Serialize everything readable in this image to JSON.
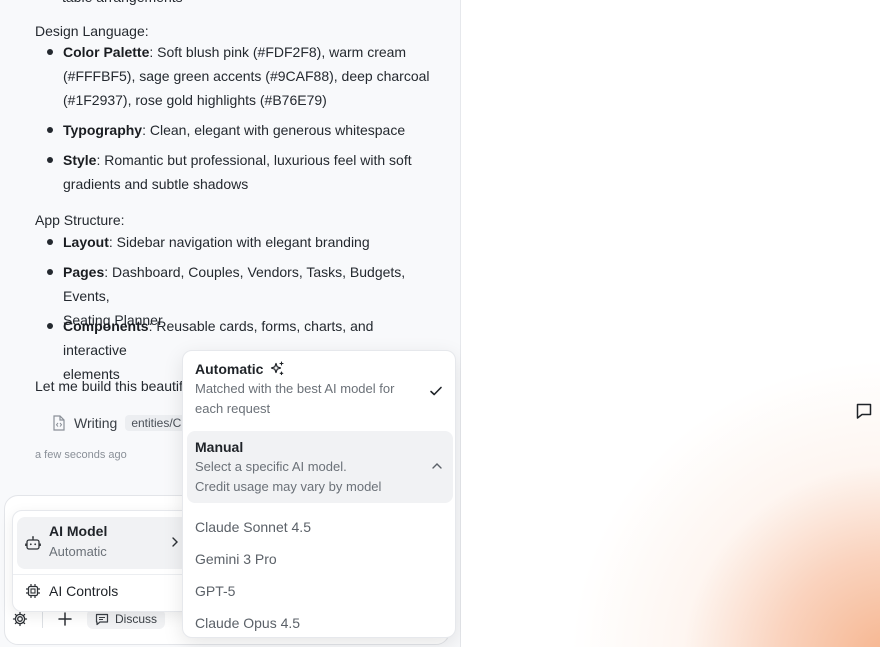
{
  "chat": {
    "cut_line": "table arrangements",
    "design_heading": "Design Language:",
    "design_items": [
      {
        "label": "Color Palette",
        "lines": [
          "Soft blush pink (#FDF2F8), warm cream",
          "(#FFFBF5), sage green accents (#9CAF88), deep charcoal",
          "(#1F2937), rose gold highlights (#B76E79)"
        ]
      },
      {
        "label": "Typography",
        "lines": [
          "Clean, elegant with generous whitespace"
        ]
      },
      {
        "label": "Style",
        "lines": [
          "Romantic but professional, luxurious feel with soft",
          "gradients and subtle shadows"
        ]
      }
    ],
    "structure_heading": "App Structure:",
    "structure_items": [
      {
        "label": "Layout",
        "lines": [
          "Sidebar navigation with elegant branding"
        ]
      },
      {
        "label": "Pages",
        "lines": [
          "Dashboard, Couples, Vendors, Tasks, Budgets, Events,",
          "Seating Planner"
        ]
      },
      {
        "label": "Components",
        "lines": [
          "Reusable cards, forms, charts, and interactive",
          "elements"
        ]
      }
    ],
    "closing_text": "Let me build this beautiful",
    "tool": {
      "action": "Writing",
      "chip": "entities/C"
    },
    "timestamp": "a few seconds ago"
  },
  "composer": {
    "discuss_label": "Discuss"
  },
  "settings_menu": {
    "model_label": "AI Model",
    "model_value": "Automatic",
    "controls_label": "AI Controls"
  },
  "model_menu": {
    "automatic": {
      "title": "Automatic",
      "desc": "Matched with the best AI model for each request",
      "selected": true
    },
    "manual": {
      "title": "Manual",
      "desc_line1": "Select a specific AI model.",
      "desc_line2": "Credit usage may vary by model"
    },
    "models": [
      "Claude Sonnet 4.5",
      "Gemini 3 Pro",
      "GPT-5",
      "Claude Opus 4.5"
    ]
  }
}
